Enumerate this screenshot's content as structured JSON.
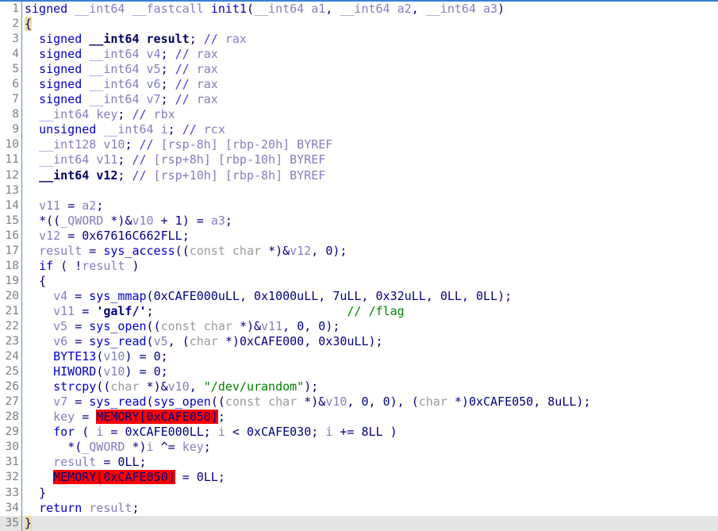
{
  "app": {
    "name": "Hex-Rays Decompiler Pseudocode",
    "function_name": "init1"
  },
  "editor": {
    "gutter_color": "#808080",
    "separator_color": "#4f8fd8",
    "background": "#ffffff",
    "current_line_background": "#e4e4e4",
    "match_brace_highlight": "#f0dda0",
    "search_highlight": "#ff0000",
    "first_line_number": 1,
    "last_line_number": 35,
    "total_lines": 35
  },
  "lines": [
    {
      "n": "1",
      "text": "signed __int64 __fastcall init1(__int64 a1, __int64 a2, __int64 a3)"
    },
    {
      "n": "2",
      "text": "{"
    },
    {
      "n": "3",
      "text": "  signed __int64 result; // rax"
    },
    {
      "n": "4",
      "text": "  signed __int64 v4; // rax"
    },
    {
      "n": "5",
      "text": "  signed __int64 v5; // rax"
    },
    {
      "n": "6",
      "text": "  signed __int64 v6; // rax"
    },
    {
      "n": "7",
      "text": "  signed __int64 v7; // rax"
    },
    {
      "n": "8",
      "text": "  __int64 key; // rbx"
    },
    {
      "n": "9",
      "text": "  unsigned __int64 i; // rcx"
    },
    {
      "n": "10",
      "text": "  __int128 v10; // [rsp-8h] [rbp-20h] BYREF"
    },
    {
      "n": "11",
      "text": "  __int64 v11; // [rsp+8h] [rbp-10h] BYREF"
    },
    {
      "n": "12",
      "text": "  __int64 v12; // [rsp+10h] [rbp-8h] BYREF"
    },
    {
      "n": "13",
      "text": ""
    },
    {
      "n": "14",
      "text": "  v11 = a2;"
    },
    {
      "n": "15",
      "text": "  *((_QWORD *)&v10 + 1) = a3;"
    },
    {
      "n": "16",
      "text": "  v12 = 0x67616C662FLL;"
    },
    {
      "n": "17",
      "text": "  result = sys_access((const char *)&v12, 0);"
    },
    {
      "n": "18",
      "text": "  if ( !result )"
    },
    {
      "n": "19",
      "text": "  {"
    },
    {
      "n": "20",
      "text": "    v4 = sys_mmap(0xCAFE000uLL, 0x1000uLL, 7uLL, 0x32uLL, 0LL, 0LL);"
    },
    {
      "n": "21",
      "text": "    v11 = 'galf/';                           // /flag"
    },
    {
      "n": "22",
      "text": "    v5 = sys_open((const char *)&v11, 0, 0);"
    },
    {
      "n": "23",
      "text": "    v6 = sys_read(v5, (char *)0xCAFE000, 0x30uLL);"
    },
    {
      "n": "24",
      "text": "    BYTE13(v10) = 0;"
    },
    {
      "n": "25",
      "text": "    HIWORD(v10) = 0;"
    },
    {
      "n": "26",
      "text": "    strcpy((char *)&v10, \"/dev/urandom\");"
    },
    {
      "n": "27",
      "text": "    v7 = sys_read(sys_open((const char *)&v10, 0, 0), (char *)0xCAFE050, 8uLL);"
    },
    {
      "n": "28",
      "text": "    key = MEMORY[0xCAFE050];"
    },
    {
      "n": "29",
      "text": "    for ( i = 0xCAFE000LL; i < 0xCAFE030; i += 8LL )"
    },
    {
      "n": "30",
      "text": "      *(_QWORD *)i ^= key;"
    },
    {
      "n": "31",
      "text": "    result = 0LL;"
    },
    {
      "n": "32",
      "text": "    MEMORY[0xCAFE050] = 0LL;"
    },
    {
      "n": "33",
      "text": "  }"
    },
    {
      "n": "34",
      "text": "  return result;"
    },
    {
      "n": "35",
      "text": "}"
    }
  ],
  "highlights": {
    "search_term": "MEMORY[0xCAFE050]",
    "highlighted_lines": [
      "28",
      "32"
    ],
    "brace_match_lines": [
      "2",
      "35"
    ],
    "current_line": "35"
  },
  "comments": {
    "line_21_trailing": "// /flag",
    "registers": [
      "rax",
      "rax",
      "rax",
      "rax",
      "rax",
      "rbx",
      "rcx"
    ],
    "stack_slots": [
      "[rsp-8h] [rbp-20h] BYREF",
      "[rsp+8h] [rbp-10h] BYREF",
      "[rsp+10h] [rbp-8h] BYREF"
    ]
  },
  "literals": {
    "flag_path_qword": "0x67616C662FLL",
    "flag_char_literal": "'galf/'",
    "urandom_path": "/dev/urandom",
    "mmap_addr": "0xCAFE000uLL",
    "mmap_len": "0x1000uLL",
    "mmap_prot": "7uLL",
    "mmap_flags": "0x32uLL",
    "read_len": "0x30uLL",
    "key_addr": "0xCAFE050",
    "loop_start": "0xCAFE000LL",
    "loop_end": "0xCAFE030",
    "loop_step": "8LL"
  }
}
